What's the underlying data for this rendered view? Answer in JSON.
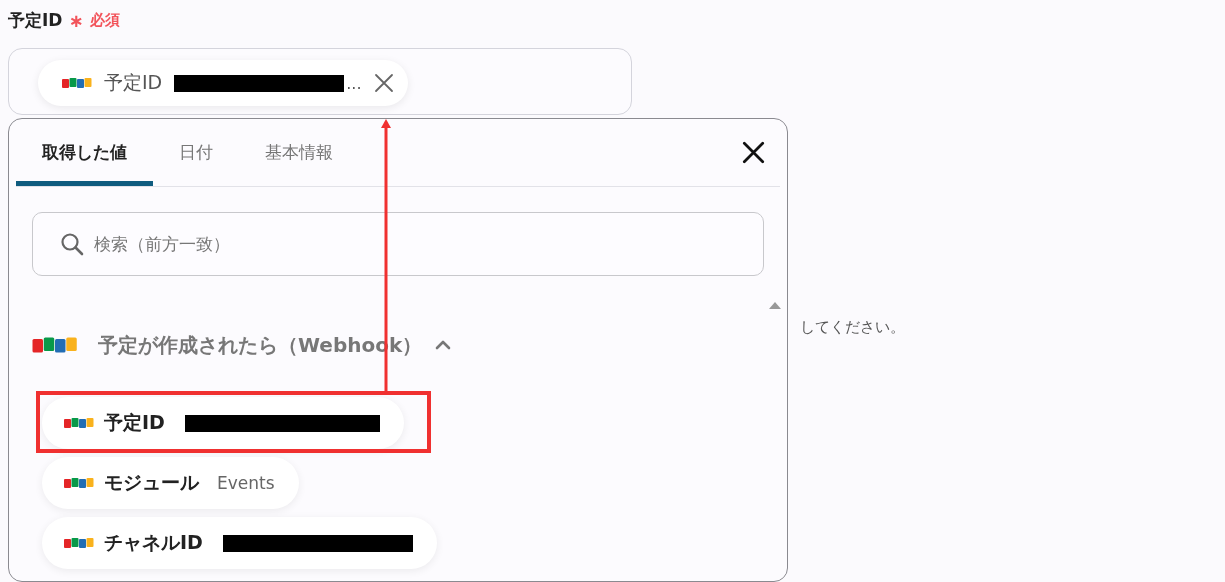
{
  "field": {
    "label": "予定ID",
    "required_mark": "∗",
    "required_text": "必須",
    "chip": {
      "label": "予定ID",
      "redacted": true,
      "ellipsis": "..."
    }
  },
  "hint": "してください。",
  "popup": {
    "tabs": [
      {
        "label": "取得した値",
        "selected": true
      },
      {
        "label": "日付",
        "selected": false
      },
      {
        "label": "基本情報",
        "selected": false
      }
    ],
    "search": {
      "placeholder": "検索（前方一致）"
    },
    "group": {
      "title": "予定が作成されたら（Webhook）",
      "expanded": true,
      "items": [
        {
          "kind": "redacted",
          "label": "予定ID",
          "highlighted": true
        },
        {
          "kind": "value",
          "label": "モジュール",
          "value": "Events",
          "highlighted": false
        },
        {
          "kind": "redacted",
          "label": "チャネルID",
          "highlighted": false
        }
      ]
    }
  }
}
